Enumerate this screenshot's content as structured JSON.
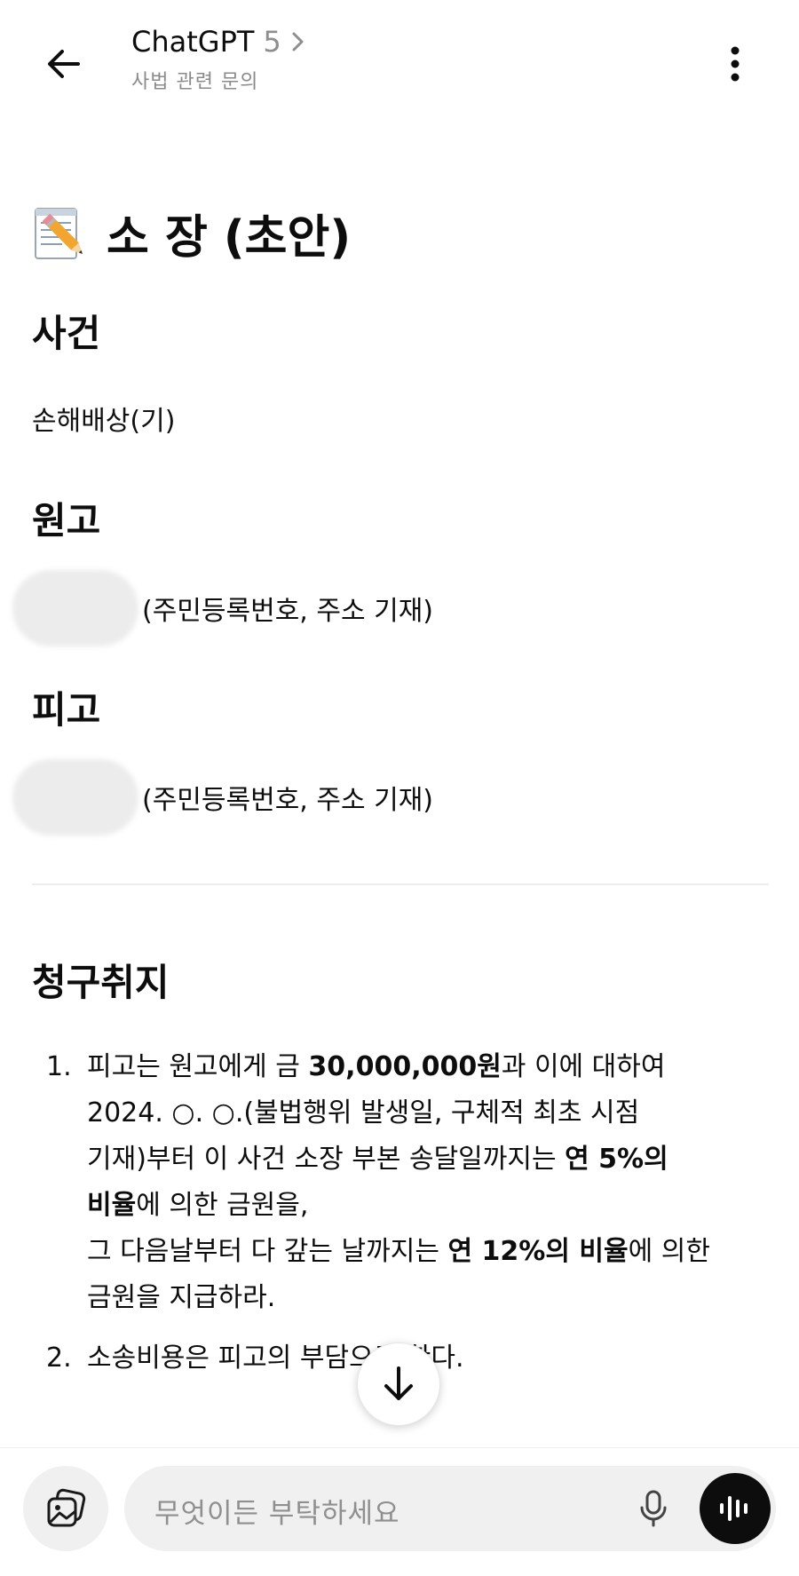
{
  "header": {
    "title": "ChatGPT",
    "version": "5",
    "subtitle": "사법 관련 문의"
  },
  "document": {
    "title": "소 장 (초안)",
    "case_heading": "사건",
    "case_value": "손해배상(기)",
    "plaintiff_heading": "원고",
    "plaintiff_info": "(주민등록번호, 주소 기재)",
    "defendant_heading": "피고",
    "defendant_info": "(주민등록번호, 주소 기재)",
    "claims_heading": "청구취지",
    "claims": [
      {
        "num": "1.",
        "parts": {
          "a": "피고는 원고에게 금 ",
          "b_bold": "30,000,000원",
          "c": "과 이에 대하여",
          "d": "2024. ○. ○.(불법행위 발생일, 구체적 최초 시점",
          "e": "기재)부터 이 사건 소장 부본 송달일까지는 ",
          "f_bold": "연 5%의",
          "g_bold": "비율",
          "h": "에 의한 금원을,",
          "i": "그 다음날부터 다 갚는 날까지는 ",
          "j_bold": "연 12%의 비율",
          "k": "에 의한",
          "l": "금원을 지급하라."
        }
      },
      {
        "num": "2.",
        "text": "소송비용은 피고의 부담으로 한다."
      }
    ]
  },
  "composer": {
    "placeholder": "무엇이든 부탁하세요"
  },
  "icons": {
    "back": "arrow-left-icon",
    "menu": "more-vertical-icon",
    "memo": "memo-icon",
    "scroll": "arrow-down-icon",
    "attach": "images-icon",
    "mic": "microphone-icon",
    "voice": "voice-waveform-icon"
  }
}
